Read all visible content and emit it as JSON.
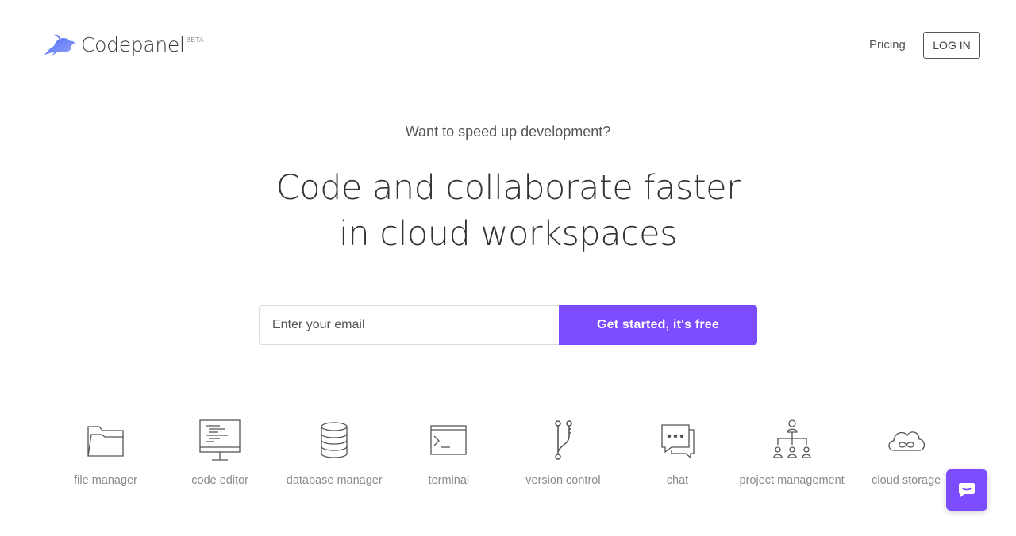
{
  "brand": {
    "name": "Codepanel",
    "badge": "BETA",
    "logo_icon": "rabbit-logo-icon",
    "accent_color": "#7c4dff"
  },
  "nav": {
    "pricing_label": "Pricing",
    "login_label": "LOG IN"
  },
  "hero": {
    "subtitle": "Want to speed up development?",
    "title_line1": "Code and collaborate faster",
    "title_line2": "in cloud workspaces"
  },
  "signup": {
    "email_placeholder": "Enter your email",
    "email_value": "",
    "cta_label": "Get started, it's free"
  },
  "features": [
    {
      "label": "file manager",
      "icon": "folder-icon"
    },
    {
      "label": "code editor",
      "icon": "monitor-code-icon"
    },
    {
      "label": "database manager",
      "icon": "database-icon"
    },
    {
      "label": "terminal",
      "icon": "terminal-icon"
    },
    {
      "label": "version control",
      "icon": "git-branch-icon"
    },
    {
      "label": "chat",
      "icon": "chat-bubble-icon"
    },
    {
      "label": "project management",
      "icon": "org-chart-icon"
    },
    {
      "label": "cloud storage",
      "icon": "cloud-infinity-icon"
    }
  ],
  "chat_widget": {
    "icon": "chat-launcher-icon"
  }
}
